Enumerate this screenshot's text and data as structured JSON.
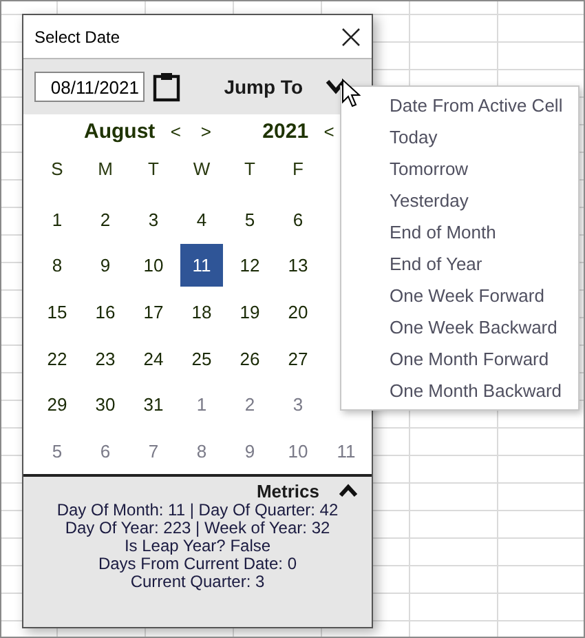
{
  "window": {
    "title": "Select Date"
  },
  "toolbar": {
    "date_value": "08/11/2021",
    "jump_label": "Jump To"
  },
  "month_nav": {
    "label": "August",
    "prev": "<",
    "next": ">"
  },
  "year_nav": {
    "label": "2021",
    "prev": "<"
  },
  "weekdays": [
    "S",
    "M",
    "T",
    "W",
    "T",
    "F"
  ],
  "weeks": [
    [
      {
        "day": "1",
        "muted": false,
        "selected": false
      },
      {
        "day": "2",
        "muted": false,
        "selected": false
      },
      {
        "day": "3",
        "muted": false,
        "selected": false
      },
      {
        "day": "4",
        "muted": false,
        "selected": false
      },
      {
        "day": "5",
        "muted": false,
        "selected": false
      },
      {
        "day": "6",
        "muted": false,
        "selected": false
      }
    ],
    [
      {
        "day": "8",
        "muted": false,
        "selected": false
      },
      {
        "day": "9",
        "muted": false,
        "selected": false
      },
      {
        "day": "10",
        "muted": false,
        "selected": false
      },
      {
        "day": "11",
        "muted": false,
        "selected": true
      },
      {
        "day": "12",
        "muted": false,
        "selected": false
      },
      {
        "day": "13",
        "muted": false,
        "selected": false
      }
    ],
    [
      {
        "day": "15",
        "muted": false,
        "selected": false
      },
      {
        "day": "16",
        "muted": false,
        "selected": false
      },
      {
        "day": "17",
        "muted": false,
        "selected": false
      },
      {
        "day": "18",
        "muted": false,
        "selected": false
      },
      {
        "day": "19",
        "muted": false,
        "selected": false
      },
      {
        "day": "20",
        "muted": false,
        "selected": false
      }
    ],
    [
      {
        "day": "22",
        "muted": false,
        "selected": false
      },
      {
        "day": "23",
        "muted": false,
        "selected": false
      },
      {
        "day": "24",
        "muted": false,
        "selected": false
      },
      {
        "day": "25",
        "muted": false,
        "selected": false
      },
      {
        "day": "26",
        "muted": false,
        "selected": false
      },
      {
        "day": "27",
        "muted": false,
        "selected": false
      }
    ],
    [
      {
        "day": "29",
        "muted": false,
        "selected": false
      },
      {
        "day": "30",
        "muted": false,
        "selected": false
      },
      {
        "day": "31",
        "muted": false,
        "selected": false
      },
      {
        "day": "1",
        "muted": true,
        "selected": false
      },
      {
        "day": "2",
        "muted": true,
        "selected": false
      },
      {
        "day": "3",
        "muted": true,
        "selected": false
      }
    ],
    [
      {
        "day": "5",
        "muted": true,
        "selected": false
      },
      {
        "day": "6",
        "muted": true,
        "selected": false
      },
      {
        "day": "7",
        "muted": true,
        "selected": false
      },
      {
        "day": "8",
        "muted": true,
        "selected": false
      },
      {
        "day": "9",
        "muted": true,
        "selected": false
      },
      {
        "day": "10",
        "muted": true,
        "selected": false
      },
      {
        "day": "11",
        "muted": true,
        "selected": false
      }
    ]
  ],
  "metrics": {
    "title": "Metrics",
    "expanded": true,
    "lines": [
      "Day Of Month: 11 |  Day Of Quarter: 42",
      "Day Of Year: 223 | Week of Year: 32",
      "Is Leap Year? False",
      "Days From Current Date: 0",
      "Current Quarter: 3"
    ]
  },
  "jump_menu": {
    "open": true,
    "items": [
      "Date From Active Cell",
      "Today",
      "Tomorrow",
      "Yesterday",
      "End of Month",
      "End of Year",
      "One Week Forward",
      "One Week Backward",
      "One Month Forward",
      "One Month Backward"
    ]
  }
}
